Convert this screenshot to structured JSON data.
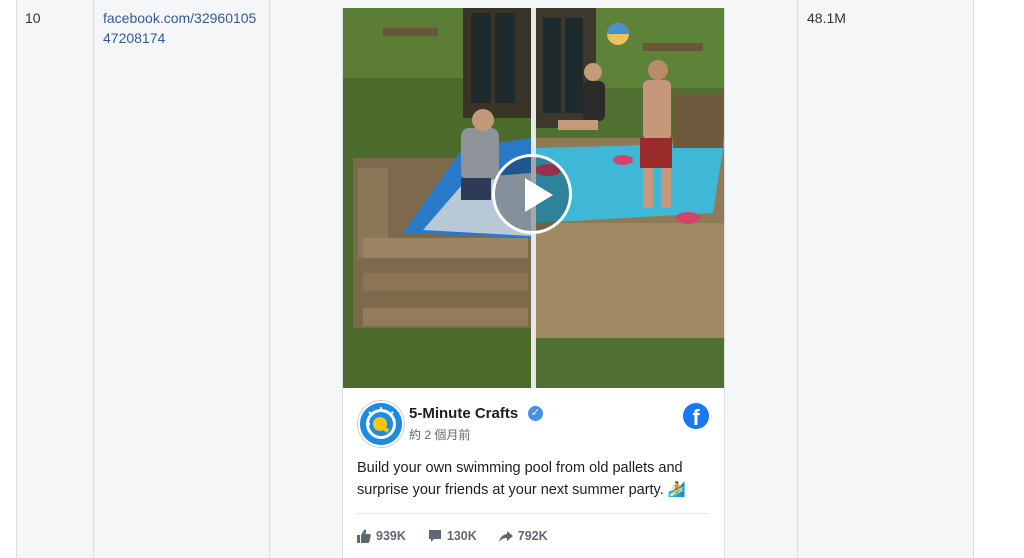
{
  "row": {
    "rank": "10",
    "link": "facebook.com/3296010547208174",
    "views": "48.1M"
  },
  "post": {
    "page_name": "5-Minute Crafts",
    "verified_icon": "verified-badge-icon",
    "time": "約 2 個月前",
    "message": "Build your own swimming pool from old pallets and surprise your friends at your next summer party. 🏄",
    "platform_icon": "facebook-icon",
    "stats": {
      "likes": "939K",
      "comments": "130K",
      "shares": "792K"
    }
  },
  "colors": {
    "link": "#385898",
    "facebook_blue": "#1877f2",
    "verified_blue": "#4a90e2",
    "table_bg": "#f5f6f8"
  }
}
